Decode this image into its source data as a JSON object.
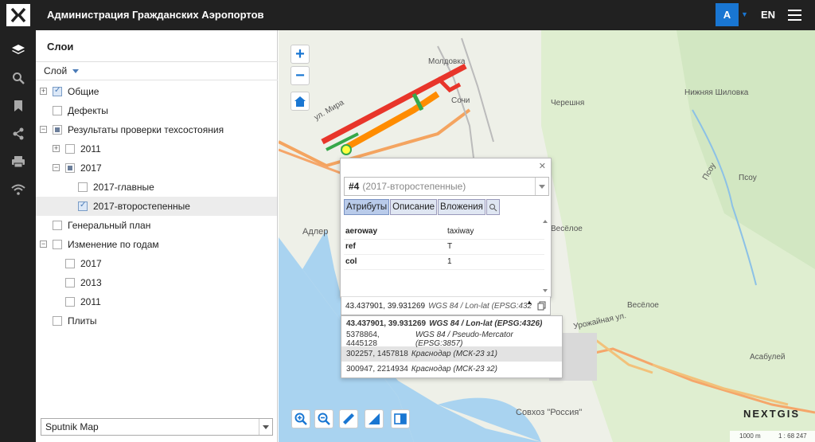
{
  "app": {
    "title": "Администрация Гражданских Аэропортов",
    "user_initial": "A",
    "lang": "EN"
  },
  "panel": {
    "title": "Слои",
    "layer_dropdown": "Слой",
    "basemap": "Sputnik Map"
  },
  "tree": [
    {
      "label": "Общие"
    },
    {
      "label": "Дефекты"
    },
    {
      "label": "Результаты проверки техсостояния"
    },
    {
      "label": "2011"
    },
    {
      "label": "2017"
    },
    {
      "label": "2017-главные"
    },
    {
      "label": "2017-второстепенные"
    },
    {
      "label": "Генеральный план"
    },
    {
      "label": "Изменение по годам"
    },
    {
      "label": "2017"
    },
    {
      "label": "2013"
    },
    {
      "label": "2011"
    },
    {
      "label": "Плиты"
    }
  ],
  "map_labels": {
    "moldovka": "Молдовка",
    "sochi": "Сочи",
    "chereshnya": "Черешня",
    "shilovka": "Нижняя Шиловка",
    "psou_v": "Псоу",
    "psou": "Псоу",
    "adler": "Адлер",
    "veseloe1": "Весёлое",
    "veseloe2": "Весёлое",
    "urozh": "Урожайная ул.",
    "asabulei": "Асабулей",
    "sovkhoz": "Совхоз \"Россия\"",
    "mira": "ул. Мира"
  },
  "popup": {
    "feature_id": "#4",
    "feature_layer": "(2017-второстепенные)",
    "tabs": [
      "Атрибуты",
      "Описание",
      "Вложения"
    ],
    "attributes": [
      {
        "key": "aeroway",
        "value": "taxiway"
      },
      {
        "key": "ref",
        "value": "T"
      },
      {
        "key": "col",
        "value": "1"
      }
    ],
    "coord_value": "43.437901, 39.931269",
    "coord_crs": "WGS 84 / Lon-lat (EPSG:432"
  },
  "crs_options": [
    {
      "coords": "43.437901, 39.931269",
      "crs": "WGS 84 / Lon-lat (EPSG:4326)"
    },
    {
      "coords": "5378864, 4445128",
      "crs": "WGS 84 / Pseudo-Mercator (EPSG:3857)"
    },
    {
      "coords": "302257, 1457818",
      "crs": "Краснодар (МСК-23 з1)"
    },
    {
      "coords": "300947, 2214934",
      "crs": "Краснодар (МСК-23 з2)"
    }
  ],
  "brand": "NEXTGIS",
  "scale": {
    "distance": "1000 m",
    "ratio": "1 : 68 247"
  },
  "colors": {
    "accent": "#1976d2",
    "topbar": "#212121"
  }
}
